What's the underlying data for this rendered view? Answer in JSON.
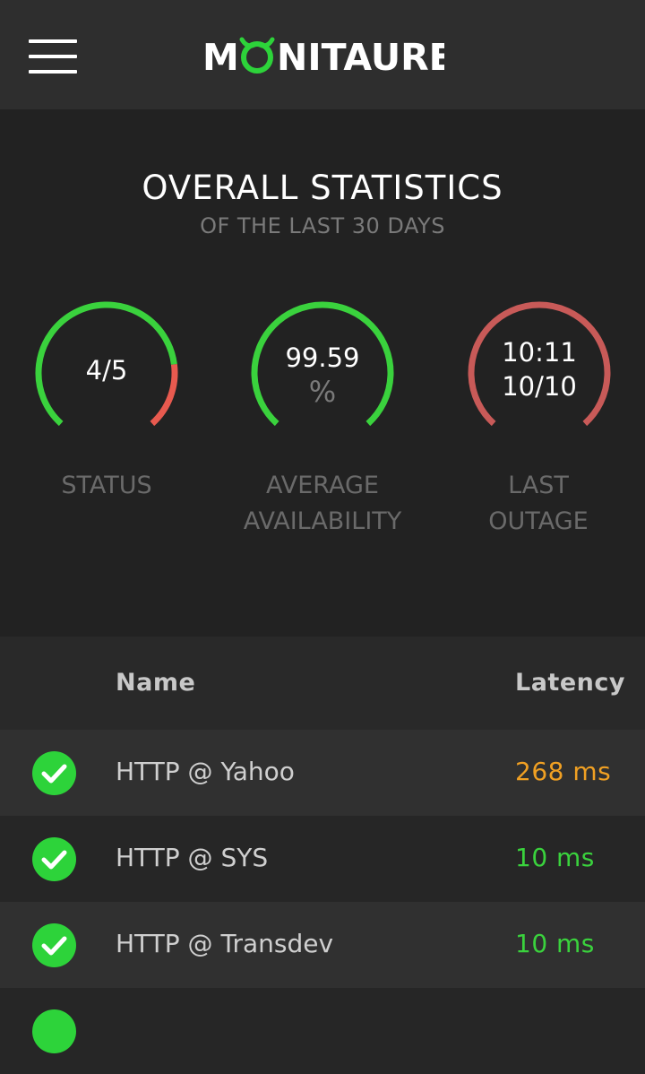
{
  "header": {
    "logo_text": "MONITAURE",
    "menu_icon": "hamburger-menu-icon",
    "accent_color": "#2dd33a"
  },
  "stats": {
    "title": "OVERALL STATISTICS",
    "subtitle": "OF THE LAST 30 DAYS",
    "gauges": [
      {
        "value": "4/5",
        "unit": "",
        "label_line1": "STATUS",
        "label_line2": "",
        "fraction_green": 0.8,
        "color_main": "#3ad23d",
        "color_rest": "#e85a4f"
      },
      {
        "value": "99.59",
        "unit": "%",
        "label_line1": "AVERAGE",
        "label_line2": "AVAILABILITY",
        "fraction_green": 1.0,
        "color_main": "#3ad23d",
        "color_rest": "#3ad23d"
      },
      {
        "value": "10:11",
        "value2": "10/10",
        "label_line1": "LAST",
        "label_line2": "OUTAGE",
        "fraction_green": 1.0,
        "color_main": "#c85a58",
        "color_rest": "#c85a58"
      }
    ]
  },
  "table": {
    "columns": {
      "name": "Name",
      "latency": "Latency"
    },
    "rows": [
      {
        "status_icon": "check-circle-icon",
        "name": "HTTP @ Yahoo",
        "latency": "268 ms",
        "latency_color": "#f0a023"
      },
      {
        "status_icon": "check-circle-icon",
        "name": "HTTP @ SYS",
        "latency": "10 ms",
        "latency_color": "#3ad23d"
      },
      {
        "status_icon": "check-circle-icon",
        "name": "HTTP @ Transdev",
        "latency": "10 ms",
        "latency_color": "#3ad23d"
      }
    ]
  }
}
